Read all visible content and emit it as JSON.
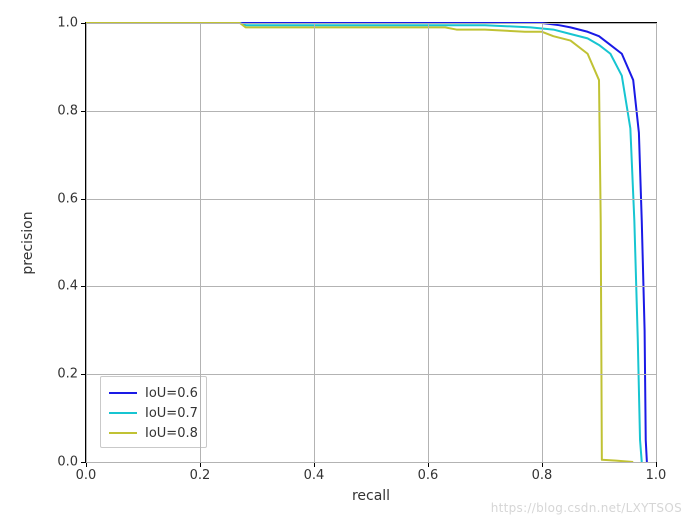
{
  "chart_data": {
    "type": "line",
    "title": "",
    "xlabel": "recall",
    "ylabel": "precision",
    "xlim": [
      0.0,
      1.0
    ],
    "ylim": [
      0.0,
      1.0
    ],
    "xticks": [
      0.0,
      0.2,
      0.4,
      0.6,
      0.8,
      1.0
    ],
    "yticks": [
      0.0,
      0.2,
      0.4,
      0.6,
      0.8,
      1.0
    ],
    "grid": true,
    "legend_position": "lower left",
    "series": [
      {
        "name": "IoU=0.6",
        "color": "#1a1ae6",
        "x": [
          0.0,
          0.3,
          0.5,
          0.7,
          0.8,
          0.83,
          0.85,
          0.88,
          0.9,
          0.92,
          0.94,
          0.96,
          0.97,
          0.975,
          0.98,
          0.982,
          0.984
        ],
        "y": [
          1.0,
          1.0,
          1.0,
          1.0,
          1.0,
          0.995,
          0.99,
          0.98,
          0.97,
          0.95,
          0.93,
          0.87,
          0.75,
          0.55,
          0.3,
          0.05,
          0.0
        ]
      },
      {
        "name": "IoU=0.7",
        "color": "#17c5d1",
        "x": [
          0.0,
          0.27,
          0.28,
          0.5,
          0.7,
          0.78,
          0.82,
          0.85,
          0.88,
          0.9,
          0.92,
          0.94,
          0.955,
          0.962,
          0.968,
          0.972,
          0.975
        ],
        "y": [
          1.0,
          1.0,
          0.995,
          0.995,
          0.995,
          0.99,
          0.985,
          0.975,
          0.965,
          0.95,
          0.93,
          0.88,
          0.76,
          0.55,
          0.28,
          0.05,
          0.0
        ]
      },
      {
        "name": "IoU=0.8",
        "color": "#c0c234",
        "x": [
          0.0,
          0.27,
          0.28,
          0.5,
          0.63,
          0.65,
          0.7,
          0.77,
          0.8,
          0.82,
          0.85,
          0.88,
          0.9,
          0.903,
          0.905,
          0.93,
          0.96
        ],
        "y": [
          1.0,
          1.0,
          0.99,
          0.99,
          0.99,
          0.985,
          0.985,
          0.98,
          0.98,
          0.97,
          0.96,
          0.93,
          0.87,
          0.55,
          0.005,
          0.003,
          0.0
        ]
      }
    ]
  },
  "legend": {
    "items": [
      {
        "label": "IoU=0.6",
        "color": "#1a1ae6"
      },
      {
        "label": "IoU=0.7",
        "color": "#17c5d1"
      },
      {
        "label": "IoU=0.8",
        "color": "#c0c234"
      }
    ]
  },
  "axis": {
    "xlabel": "recall",
    "ylabel": "precision",
    "xticks_labels": [
      "0.0",
      "0.2",
      "0.4",
      "0.6",
      "0.8",
      "1.0"
    ],
    "yticks_labels": [
      "0.0",
      "0.2",
      "0.4",
      "0.6",
      "0.8",
      "1.0"
    ]
  },
  "watermark": "https://blog.csdn.net/LXYTSOS"
}
